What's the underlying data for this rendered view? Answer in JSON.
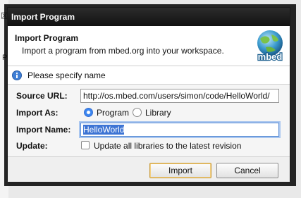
{
  "window": {
    "title": "Import Program"
  },
  "background": {
    "glyph_top": "区",
    "glyph_side": "P"
  },
  "header": {
    "title": "Import Program",
    "description": "Import a program from mbed.org into your workspace.",
    "logo_text": "mbed"
  },
  "info": {
    "message": "Please specify name"
  },
  "form": {
    "source_url_label": "Source URL:",
    "source_url_value": "http://os.mbed.com/users/simon/code/HelloWorld/",
    "import_as_label": "Import As:",
    "import_as_options": [
      {
        "label": "Program",
        "selected": true
      },
      {
        "label": "Library",
        "selected": false
      }
    ],
    "import_name_label": "Import Name:",
    "import_name_value": "HelloWorld",
    "update_label": "Update:",
    "update_checkbox_label": "Update all libraries to the latest revision",
    "update_checked": false
  },
  "buttons": {
    "import_label": "Import",
    "cancel_label": "Cancel"
  },
  "colors": {
    "titlebar": "#1e1e1e",
    "accent": "#3a86f0",
    "default_button_border": "#c99a38"
  }
}
